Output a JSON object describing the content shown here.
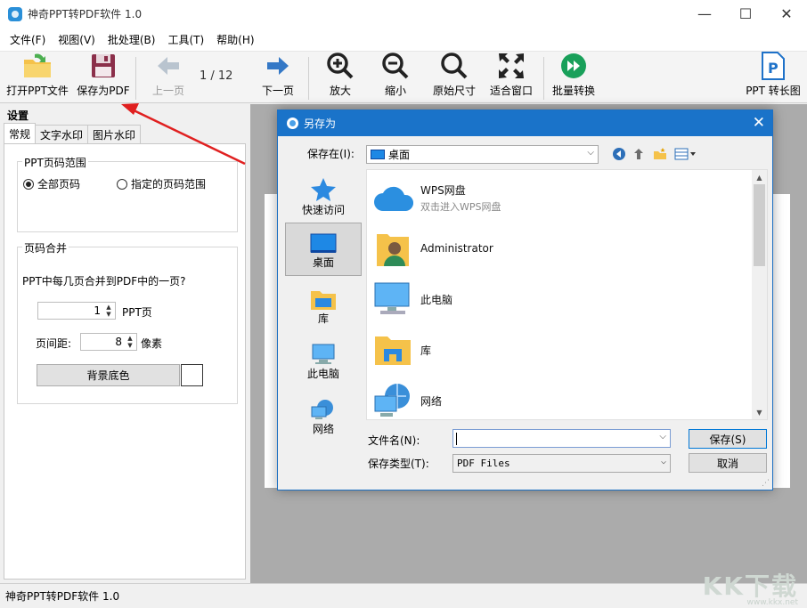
{
  "app": {
    "title": "神奇PPT转PDF软件 1.0",
    "status": "神奇PPT转PDF软件 1.0"
  },
  "window_controls": {
    "minimize": "—",
    "maximize": "☐",
    "close": "✕"
  },
  "menu": [
    "文件(F)",
    "视图(V)",
    "批处理(B)",
    "工具(T)",
    "帮助(H)"
  ],
  "toolbar": {
    "open_ppt": "打开PPT文件",
    "save_pdf": "保存为PDF",
    "prev_page": "上一页",
    "page_indicator": "1 / 12",
    "next_page": "下一页",
    "zoom_in": "放大",
    "zoom_out": "缩小",
    "actual_size": "原始尺寸",
    "fit_window": "适合窗口",
    "batch_convert": "批量转换",
    "ppt_to_long_image": "PPT 转长图"
  },
  "settings": {
    "title": "设置",
    "tabs": [
      "常规",
      "文字水印",
      "图片水印"
    ],
    "page_range": {
      "legend": "PPT页码范围",
      "option_all": "全部页码",
      "option_custom": "指定的页码范围"
    },
    "merge": {
      "legend": "页码合并",
      "question": "PPT中每几页合并到PDF中的一页?",
      "pages_value": "1",
      "pages_unit": "PPT页",
      "gap_label": "页间距:",
      "gap_value": "8",
      "gap_unit": "像素",
      "bg_color_button": "背景底色"
    }
  },
  "dialog": {
    "title": "另存为",
    "save_in_label": "保存在(I):",
    "save_in_value": "桌面",
    "places": [
      "快速访问",
      "桌面",
      "库",
      "此电脑",
      "网络"
    ],
    "files": [
      {
        "name": "WPS网盘",
        "sub": "双击进入WPS网盘"
      },
      {
        "name": "Administrator",
        "sub": ""
      },
      {
        "name": "此电脑",
        "sub": ""
      },
      {
        "name": "库",
        "sub": ""
      },
      {
        "name": "网络",
        "sub": ""
      }
    ],
    "filename_label": "文件名(N):",
    "filename_value": "",
    "filetype_label": "保存类型(T):",
    "filetype_value": "PDF Files",
    "save_button": "保存(S)",
    "cancel_button": "取消"
  },
  "watermark": {
    "text": "KK下载",
    "url": "www.kkx.net"
  },
  "colors": {
    "dialog_title": "#1a73c9",
    "arrow": "#e02020",
    "preview_bg": "#ababab"
  }
}
